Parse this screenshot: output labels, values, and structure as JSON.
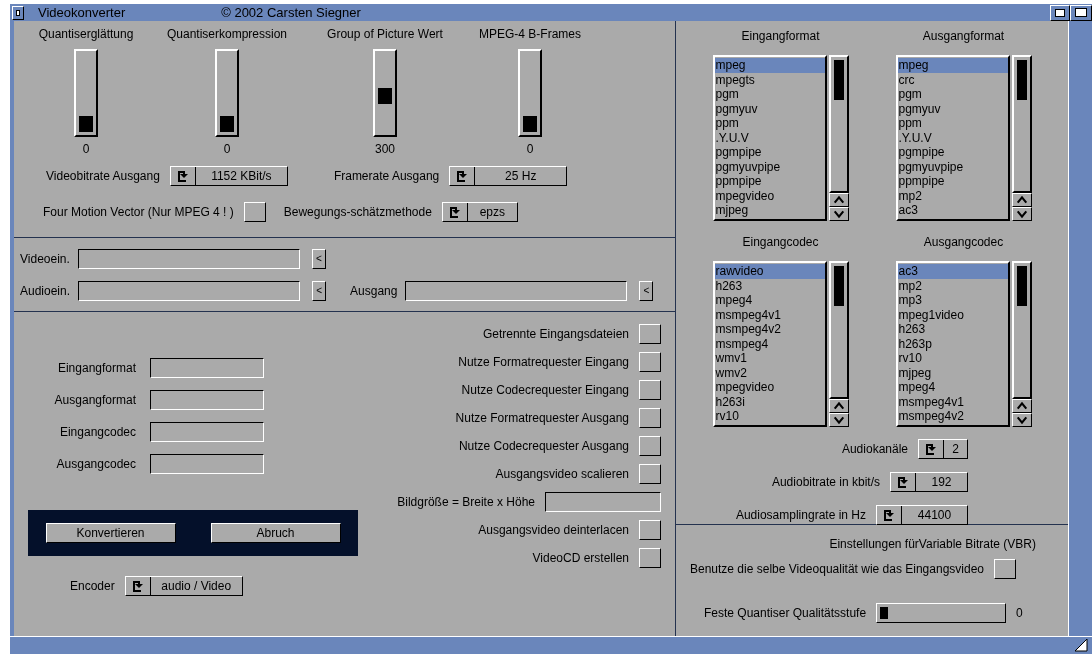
{
  "window": {
    "title": "Videokonverter",
    "copyright": "© 2002 Carsten Siegner"
  },
  "sliders": [
    {
      "label": "Quantiserglättung",
      "value": "0"
    },
    {
      "label": "Quantiserkompression",
      "value": "0"
    },
    {
      "label": "Group of Picture Wert",
      "value": "300",
      "level": 0.45
    },
    {
      "label": "MPEG-4 B-Frames",
      "value": "0"
    }
  ],
  "rate_cycles": [
    {
      "label": "Videobitrate Ausgang",
      "value": "1152 KBit/s"
    },
    {
      "label": "Framerate Ausgang",
      "value": "25 Hz"
    }
  ],
  "four_motion": {
    "label": "Four Motion Vector (Nur MPEG 4 ! )",
    "checked": false
  },
  "motion_method": {
    "label": "Bewegungs-schätzmethode",
    "value": "epzs"
  },
  "files": [
    {
      "label": "Videoein.",
      "button": "<"
    },
    {
      "label": "Audioein.",
      "button": "<"
    },
    {
      "label": "Ausgang",
      "button": "<"
    }
  ],
  "info_fields": [
    {
      "label": "Eingangformat"
    },
    {
      "label": "Ausgangformat"
    },
    {
      "label": "Eingangcodec"
    },
    {
      "label": "Ausgangcodec"
    }
  ],
  "options": [
    {
      "kind": "checkbox",
      "label": "Getrennte Eingangsdateien",
      "checked": false
    },
    {
      "kind": "checkbox",
      "label": "Nutze Formatrequester Eingang",
      "checked": false
    },
    {
      "kind": "checkbox",
      "label": "Nutze Codecrequester Eingang",
      "checked": false
    },
    {
      "kind": "checkbox",
      "label": "Nutze Formatrequester Ausgang",
      "checked": false
    },
    {
      "kind": "checkbox",
      "label": "Nutze Codecrequester Ausgang",
      "checked": false
    },
    {
      "kind": "checkbox",
      "label": "Ausgangsvideo scalieren",
      "checked": false
    },
    {
      "kind": "field",
      "label": "Bildgröße = Breite x Höhe"
    },
    {
      "kind": "checkbox",
      "label": "Ausgangsvideo deinterlacen",
      "checked": false
    },
    {
      "kind": "checkbox",
      "label": "VideoCD erstellen",
      "checked": false
    }
  ],
  "buttons": [
    "Konvertieren",
    "Abruch"
  ],
  "encoder": {
    "label": "Encoder",
    "value": "audio / Video"
  },
  "lists": [
    {
      "title": "Eingangformat",
      "items": [
        {
          "label": "mpeg",
          "selected": true
        },
        {
          "label": "mpegts",
          "selected": false
        },
        {
          "label": "pgm",
          "selected": false
        },
        {
          "label": "pgmyuv",
          "selected": false
        },
        {
          "label": "ppm",
          "selected": false
        },
        {
          "label": ".Y.U.V",
          "selected": false
        },
        {
          "label": "pgmpipe",
          "selected": false
        },
        {
          "label": "pgmyuvpipe",
          "selected": false
        },
        {
          "label": "ppmpipe",
          "selected": false
        },
        {
          "label": "mpegvideo",
          "selected": false
        },
        {
          "label": "mjpeg",
          "selected": false
        }
      ]
    },
    {
      "title": "Ausgangformat",
      "items": [
        {
          "label": "mpeg",
          "selected": true
        },
        {
          "label": "crc",
          "selected": false
        },
        {
          "label": "pgm",
          "selected": false
        },
        {
          "label": "pgmyuv",
          "selected": false
        },
        {
          "label": "ppm",
          "selected": false
        },
        {
          "label": ".Y.U.V",
          "selected": false
        },
        {
          "label": "pgmpipe",
          "selected": false
        },
        {
          "label": "pgmyuvpipe",
          "selected": false
        },
        {
          "label": "ppmpipe",
          "selected": false
        },
        {
          "label": "mp2",
          "selected": false
        },
        {
          "label": "ac3",
          "selected": false
        }
      ]
    },
    {
      "title": "Eingangcodec",
      "items": [
        {
          "label": "rawvideo",
          "selected": true
        },
        {
          "label": "h263",
          "selected": false
        },
        {
          "label": "mpeg4",
          "selected": false
        },
        {
          "label": "msmpeg4v1",
          "selected": false
        },
        {
          "label": "msmpeg4v2",
          "selected": false
        },
        {
          "label": "msmpeg4",
          "selected": false
        },
        {
          "label": "wmv1",
          "selected": false
        },
        {
          "label": "wmv2",
          "selected": false
        },
        {
          "label": "mpegvideo",
          "selected": false
        },
        {
          "label": "h263i",
          "selected": false
        },
        {
          "label": "rv10",
          "selected": false
        }
      ]
    },
    {
      "title": "Ausgangcodec",
      "items": [
        {
          "label": "ac3",
          "selected": true
        },
        {
          "label": "mp2",
          "selected": false
        },
        {
          "label": "mp3",
          "selected": false
        },
        {
          "label": "mpeg1video",
          "selected": false
        },
        {
          "label": "h263",
          "selected": false
        },
        {
          "label": "h263p",
          "selected": false
        },
        {
          "label": "rv10",
          "selected": false
        },
        {
          "label": "mjpeg",
          "selected": false
        },
        {
          "label": "mpeg4",
          "selected": false
        },
        {
          "label": "msmpeg4v1",
          "selected": false
        },
        {
          "label": "msmpeg4v2",
          "selected": false
        }
      ]
    }
  ],
  "audio_cycles": [
    {
      "label": "Audiokanäle",
      "value": "2"
    },
    {
      "label": "Audiobitrate in kbit/s",
      "value": "192"
    },
    {
      "label": "Audiosamplingrate in Hz",
      "value": "44100"
    }
  ],
  "vbr": {
    "title": "Einstellungen fürVariable Bitrate (VBR)",
    "same_quality": {
      "label": "Benutze die selbe Videoqualität wie das Eingangsvideo",
      "checked": false
    },
    "quantiser": {
      "label": "Feste Quantiser Qualitätsstufe",
      "value": "0"
    }
  }
}
